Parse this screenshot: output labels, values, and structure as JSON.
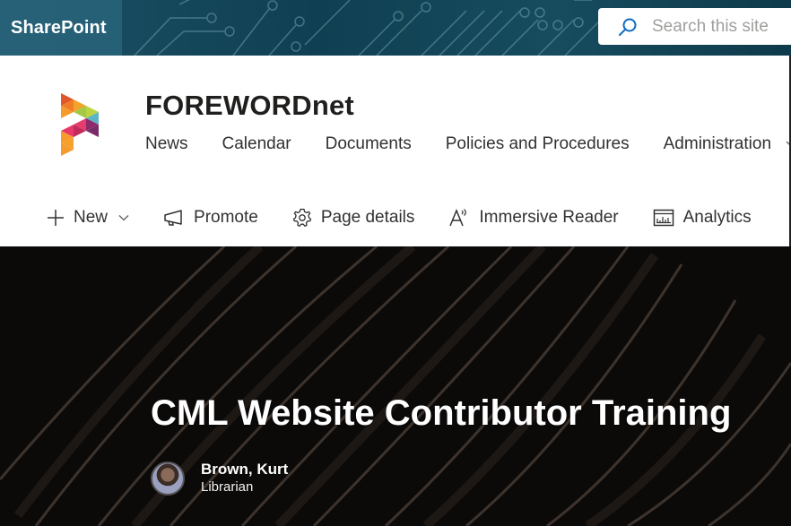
{
  "suite_bar": {
    "app_name": "SharePoint",
    "search": {
      "placeholder": "Search this site",
      "value": "",
      "icon": "search-icon"
    }
  },
  "site": {
    "title": "FOREWORDnet",
    "logo": "forewordnet-logo",
    "nav": [
      {
        "label": "News"
      },
      {
        "label": "Calendar"
      },
      {
        "label": "Documents"
      },
      {
        "label": "Policies and Procedures"
      },
      {
        "label": "Administration",
        "has_dropdown": true
      }
    ]
  },
  "command_bar": [
    {
      "label": "New",
      "icon": "plus-icon",
      "has_dropdown": true
    },
    {
      "label": "Promote",
      "icon": "megaphone-icon"
    },
    {
      "label": "Page details",
      "icon": "gear-icon"
    },
    {
      "label": "Immersive Reader",
      "icon": "immersive-reader-icon"
    },
    {
      "label": "Analytics",
      "icon": "analytics-icon"
    }
  ],
  "hero": {
    "title": "CML Website Contributor Training",
    "author": {
      "name": "Brown, Kurt",
      "role": "Librarian"
    }
  },
  "colors": {
    "suite_bar": "#0f3f52",
    "brand_box": "#28647a",
    "search_icon": "#0f6cbd",
    "hero_bg": "#0c0a09"
  }
}
